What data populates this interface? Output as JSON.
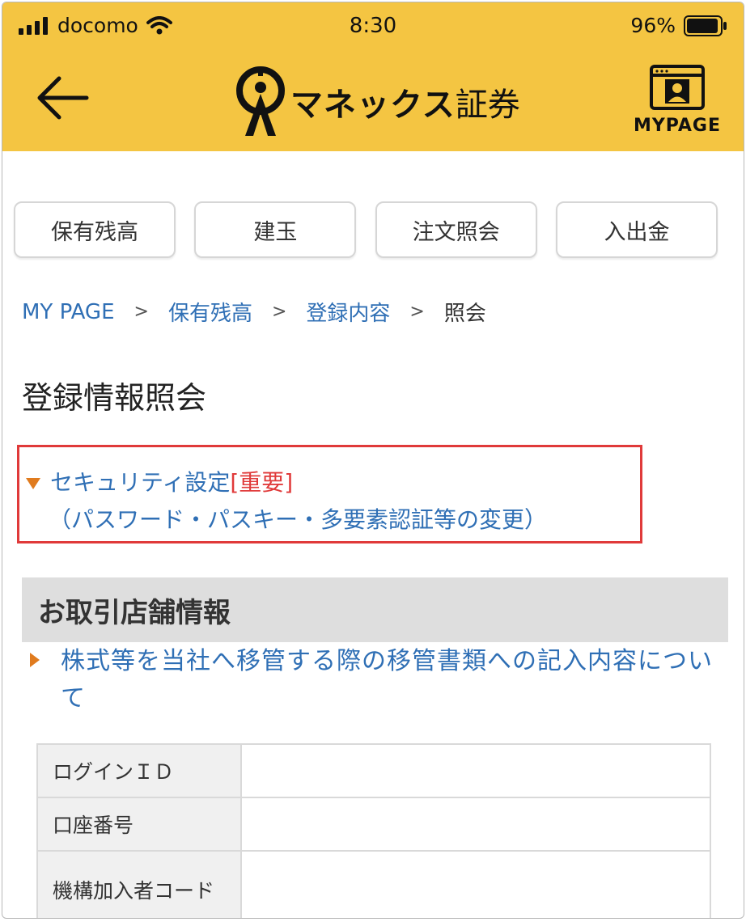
{
  "status_bar": {
    "carrier": "docomo",
    "time": "8:30",
    "battery": "96%"
  },
  "header": {
    "logo_text": "マネックス",
    "logo_text_suffix": "証券",
    "mypage_label": "MYPAGE",
    "background": "#f4c542"
  },
  "tabs": [
    {
      "label": "保有残高"
    },
    {
      "label": "建玉"
    },
    {
      "label": "注文照会"
    },
    {
      "label": "入出金"
    }
  ],
  "breadcrumb": [
    {
      "label": "MY PAGE"
    },
    {
      "label": "保有残高"
    },
    {
      "label": "登録内容"
    },
    {
      "label": "照会"
    }
  ],
  "breadcrumb_separator": ">",
  "page_title": "登録情報照会",
  "security_link": {
    "label": "セキュリティ設定",
    "badge": "[重要]",
    "sub_label": "（パスワード・パスキー・多要素認証等の変更）",
    "highlight_color": "#e03a3a"
  },
  "store_section": {
    "title": "お取引店舗情報",
    "transfer_link": "株式等を当社へ移管する際の移管書類への記入内容について"
  },
  "info_table": {
    "rows": [
      {
        "label": "ログインＩＤ",
        "value": ""
      },
      {
        "label": "口座番号",
        "value": ""
      },
      {
        "label": "機構加入者コード",
        "value": ""
      }
    ]
  },
  "colors": {
    "link": "#2f6fb5",
    "accent_arrow": "#e07b1e",
    "section_bg": "#dedede"
  }
}
